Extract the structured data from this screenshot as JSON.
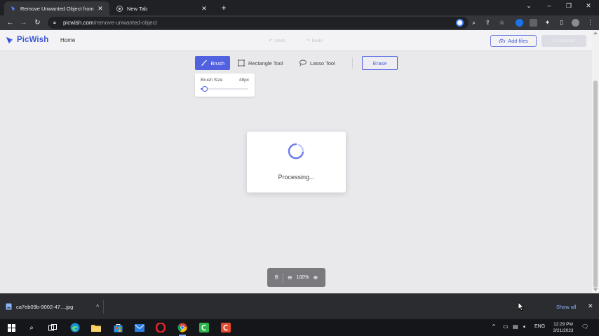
{
  "browser": {
    "tabs": [
      {
        "title": "Remove Unwanted Object from",
        "active": true
      },
      {
        "title": "New Tab",
        "active": false
      }
    ],
    "url_host": "picwish.com",
    "url_path": "/remove-unwanted-object"
  },
  "app": {
    "logo_text": "PicWish",
    "nav_home": "Home",
    "undo_label": "Undo",
    "redo_label": "Redo",
    "add_files_label": "Add files",
    "download_label": "Download",
    "accent_color": "#5161e0"
  },
  "tools": {
    "brush": "Brush",
    "rectangle": "Rectangle Tool",
    "lasso": "Lasso Tool",
    "erase": "Erase",
    "brush_size_label": "Brush Size",
    "brush_size_value": "48px",
    "brush_size_fraction": 0.05
  },
  "processing": {
    "message": "Processing..."
  },
  "zoom": {
    "level": "100%"
  },
  "downloads": {
    "file_name": "ca7eb09b-9002-47....jpg",
    "show_all": "Show all"
  },
  "taskbar": {
    "language": "ENG",
    "time": "12:29 PM",
    "date": "3/21/2023"
  }
}
